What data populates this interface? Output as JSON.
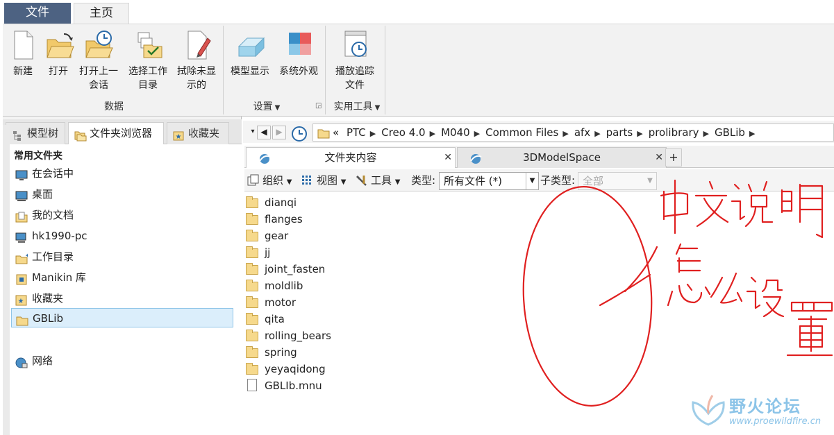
{
  "ribbon": {
    "tabs": [
      {
        "label": "文件"
      },
      {
        "label": "主页"
      }
    ],
    "buttons": [
      {
        "label1": "新建",
        "label2": ""
      },
      {
        "label1": "打开",
        "label2": ""
      },
      {
        "label1": "打开上一",
        "label2": "会话"
      },
      {
        "label1": "选择工作",
        "label2": "目录"
      },
      {
        "label1": "拭除未显",
        "label2": "示的"
      },
      {
        "label1": "模型显示",
        "label2": ""
      },
      {
        "label1": "系统外观",
        "label2": ""
      },
      {
        "label1": "播放追踪",
        "label2": "文件"
      }
    ],
    "groups": [
      {
        "label": "数据"
      },
      {
        "label": "设置"
      },
      {
        "label": "实用工具"
      }
    ]
  },
  "left_panel": {
    "tabs": [
      {
        "label": "模型树"
      },
      {
        "label": "文件夹浏览器"
      },
      {
        "label": "收藏夹"
      }
    ],
    "section_title": "常用文件夹",
    "items": [
      {
        "label": "在会话中"
      },
      {
        "label": "桌面"
      },
      {
        "label": "我的文档"
      },
      {
        "label": "hk1990-pc"
      },
      {
        "label": "工作目录"
      },
      {
        "label": "Manikin 库"
      },
      {
        "label": "收藏夹"
      },
      {
        "label": "GBLib"
      },
      {
        "label": "网络"
      }
    ]
  },
  "address": {
    "prefix": "«",
    "crumbs": [
      "PTC",
      "Creo 4.0",
      "M040",
      "Common Files",
      "afx",
      "parts",
      "prolibrary",
      "GBLib"
    ]
  },
  "file_tabs": [
    {
      "label": "文件夹内容"
    },
    {
      "label": "3DModelSpace"
    }
  ],
  "toolbar": {
    "organize": "组织",
    "view": "视图",
    "tools": "工具",
    "type_label": "类型:",
    "type_value": "所有文件 (*)",
    "subtype_label": "子类型:",
    "subtype_value": "全部"
  },
  "files": [
    {
      "name": "dianqi",
      "kind": "folder"
    },
    {
      "name": "flanges",
      "kind": "folder"
    },
    {
      "name": "gear",
      "kind": "folder"
    },
    {
      "name": "jj",
      "kind": "folder"
    },
    {
      "name": "joint_fasten",
      "kind": "folder"
    },
    {
      "name": "moldlib",
      "kind": "folder"
    },
    {
      "name": "motor",
      "kind": "folder"
    },
    {
      "name": "qita",
      "kind": "folder"
    },
    {
      "name": "rolling_bears",
      "kind": "folder"
    },
    {
      "name": "spring",
      "kind": "folder"
    },
    {
      "name": "yeyaqidong",
      "kind": "folder"
    },
    {
      "name": "GBLIb.mnu",
      "kind": "file"
    }
  ],
  "watermark": {
    "name": "野火论坛",
    "url": "www.proewildfire.cn"
  },
  "colors": {
    "file_tab": "#4d6282",
    "selection": "#dbeefb",
    "annotation": "#e02020",
    "watermark": "#8cc4e8"
  }
}
